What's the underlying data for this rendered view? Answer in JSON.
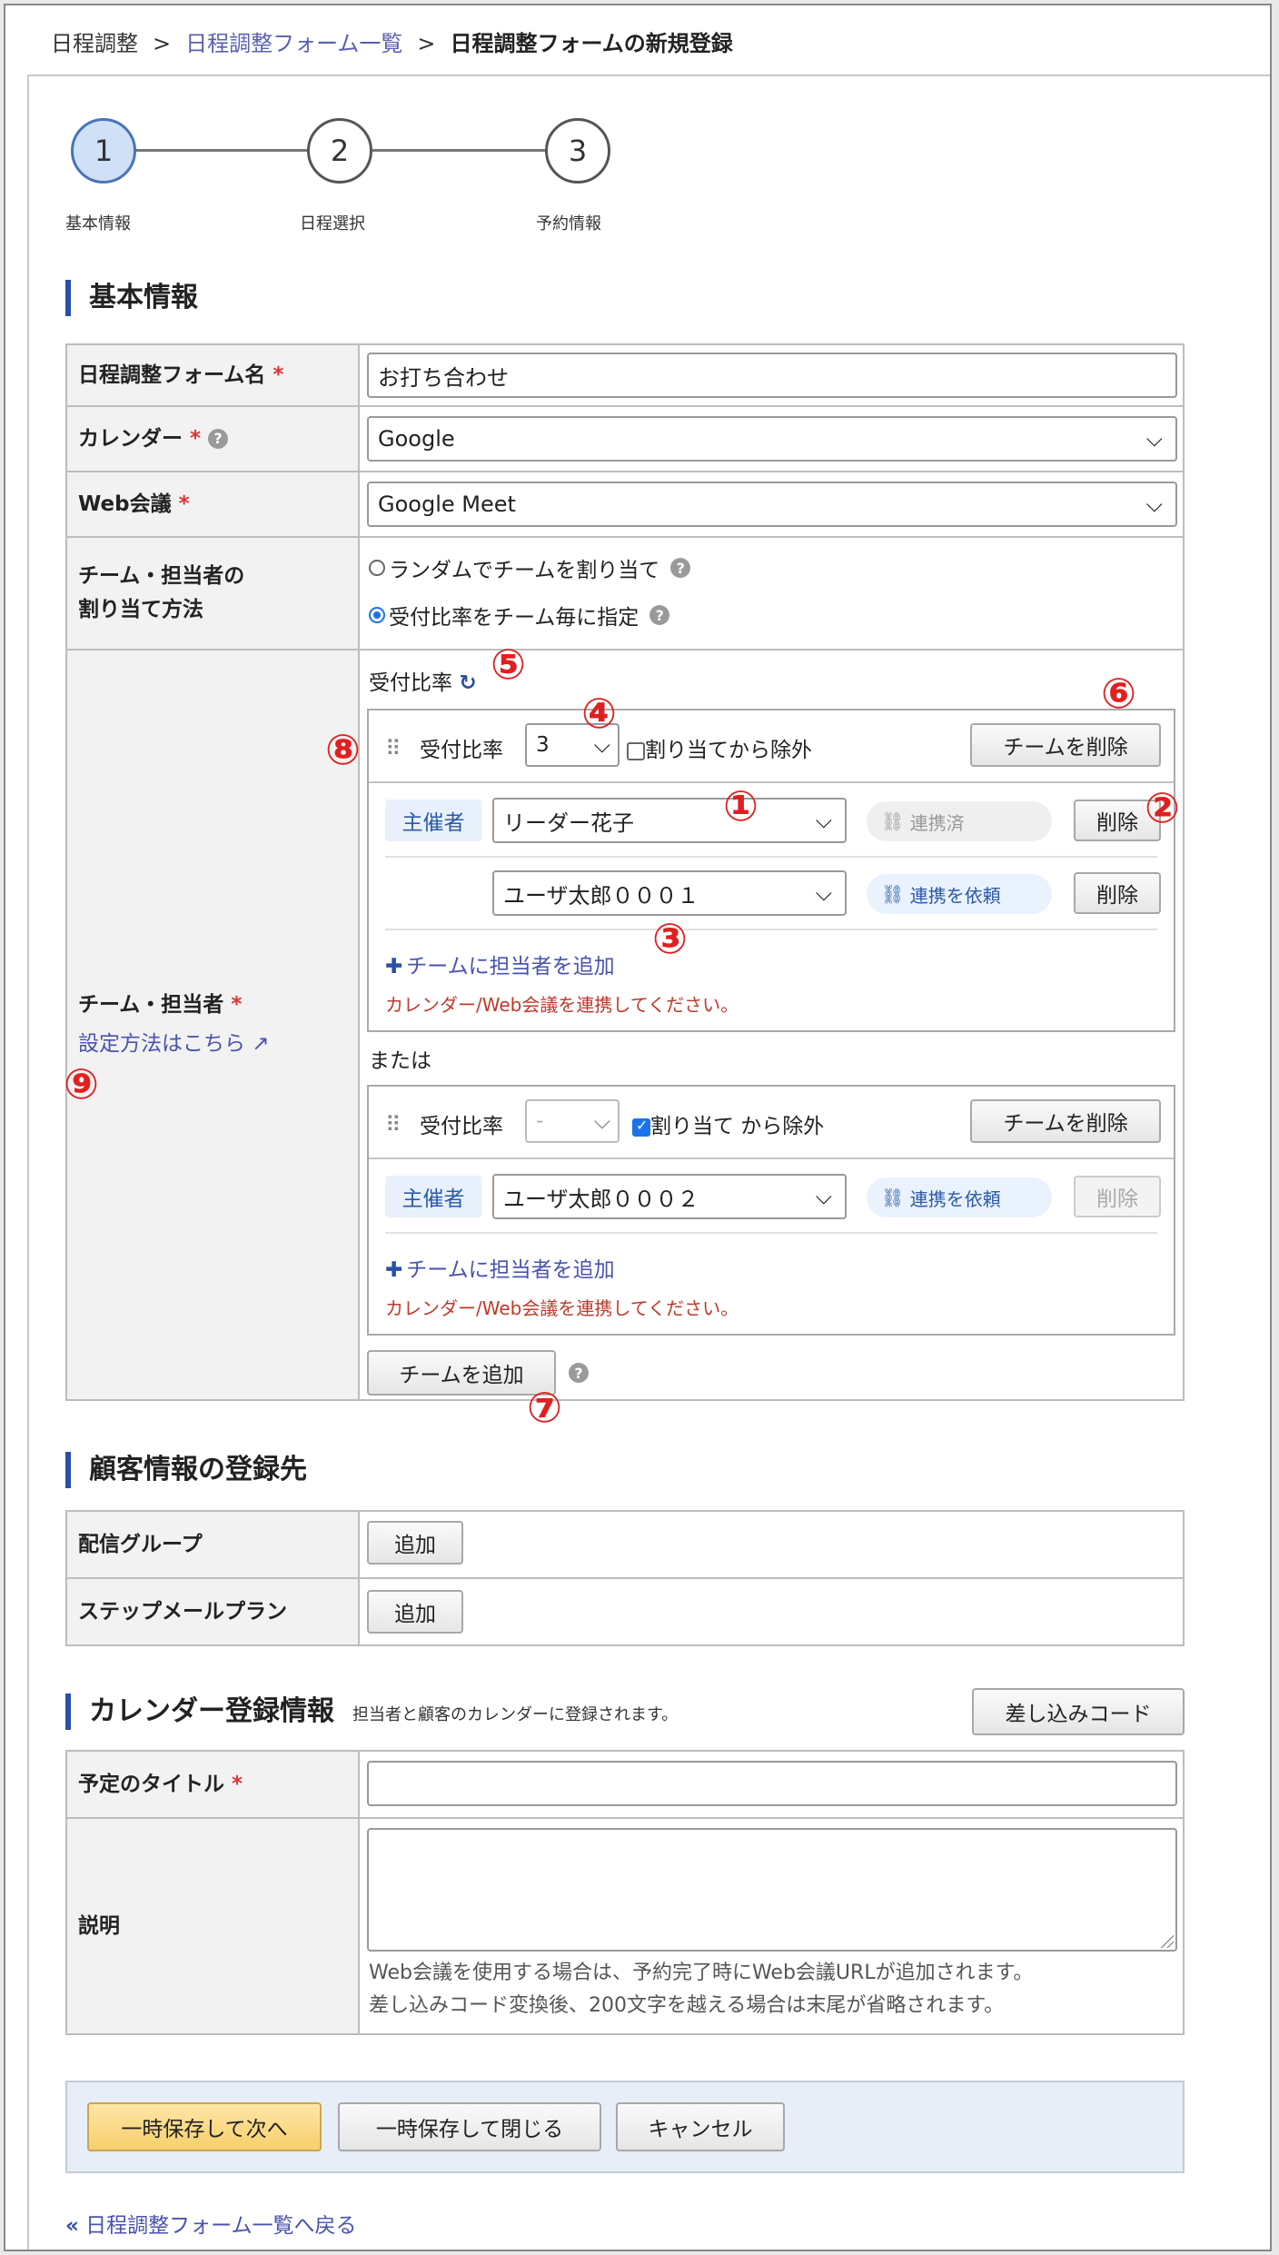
{
  "breadcrumb": {
    "items": [
      "日程調整",
      "日程調整フォーム一覧",
      "日程調整フォームの新規登録"
    ],
    "separator": ">"
  },
  "steps": [
    {
      "number": "1",
      "label": "基本情報",
      "active": true
    },
    {
      "number": "2",
      "label": "日程選択",
      "active": false
    },
    {
      "number": "3",
      "label": "予約情報",
      "active": false
    }
  ],
  "basic": {
    "section_title": "基本情報",
    "form_name_label": "日程調整フォーム名",
    "form_name_value": "お打ち合わせ",
    "calendar_label": "カレンダー",
    "calendar_value": "Google",
    "webmeeting_label": "Web会議",
    "webmeeting_value": "Google Meet",
    "assign_label_line1": "チーム・担当者の",
    "assign_label_line2": "割り当て方法",
    "assign_option_random": "ランダムでチームを割り当て",
    "assign_option_ratio": "受付比率をチーム毎に指定",
    "team_label": "チーム・担当者",
    "settings_link": "設定方法はこちら",
    "ratio_heading": "受付比率",
    "required_mark": "*",
    "help_mark": "?"
  },
  "team1": {
    "ratio_label": "受付比率",
    "ratio_value": "3",
    "exclude_label": "割り当てから除外",
    "delete_team": "チームを削除",
    "members": [
      {
        "tag": "主催者",
        "name": "リーダー花子",
        "status": "連携済",
        "delete": "削除"
      },
      {
        "tag": "",
        "name": "ユーザ太郎０００１",
        "status": "連携を依頼",
        "delete": "削除"
      }
    ],
    "add_member": "チームに担当者を追加",
    "warning": "カレンダー/Web会議を連携してください。"
  },
  "or_label": "または",
  "team2": {
    "ratio_label": "受付比率",
    "ratio_value": "-",
    "exclude_label": "割り当て から除外",
    "delete_team": "チームを削除",
    "members": [
      {
        "tag": "主催者",
        "name": "ユーザ太郎０００２",
        "status": "連携を依頼",
        "delete": "削除"
      }
    ],
    "add_member": "チームに担当者を追加",
    "warning": "カレンダー/Web会議を連携してください。"
  },
  "add_team": "チームを追加",
  "customer": {
    "section_title": "顧客情報の登録先",
    "group_label": "配信グループ",
    "group_button": "追加",
    "stepmail_label": "ステップメールプラン",
    "stepmail_button": "追加"
  },
  "calendar_reg": {
    "section_title": "カレンダー登録情報",
    "section_note": "担当者と顧客のカレンダーに登録されます。",
    "insert_code": "差し込みコード",
    "title_label": "予定のタイトル",
    "title_value": "",
    "desc_label": "説明",
    "note_line1": "Web会議を使用する場合は、予約完了時にWeb会議URLが追加されます。",
    "note_line2": "差し込みコード変換後、200文字を越える場合は末尾が省略されます。"
  },
  "footer": {
    "save_next": "一時保存して次へ",
    "save_close": "一時保存して閉じる",
    "cancel": "キャンセル"
  },
  "back_link": "日程調整フォーム一覧へ戻る",
  "markers": [
    "①",
    "②",
    "③",
    "④",
    "⑤",
    "⑥",
    "⑦",
    "⑧",
    "⑨"
  ],
  "colors": {
    "accent": "#2a4fa6",
    "required": "#dd3333",
    "warning": "#c0392b",
    "marker": "#e02020",
    "primary_button": "#f7cf6b"
  },
  "icons": {
    "refresh": "refresh-icon",
    "link": "link-icon",
    "external": "external-link-icon",
    "drag": "drag-handle-icon",
    "back": "double-chevron-left-icon"
  }
}
